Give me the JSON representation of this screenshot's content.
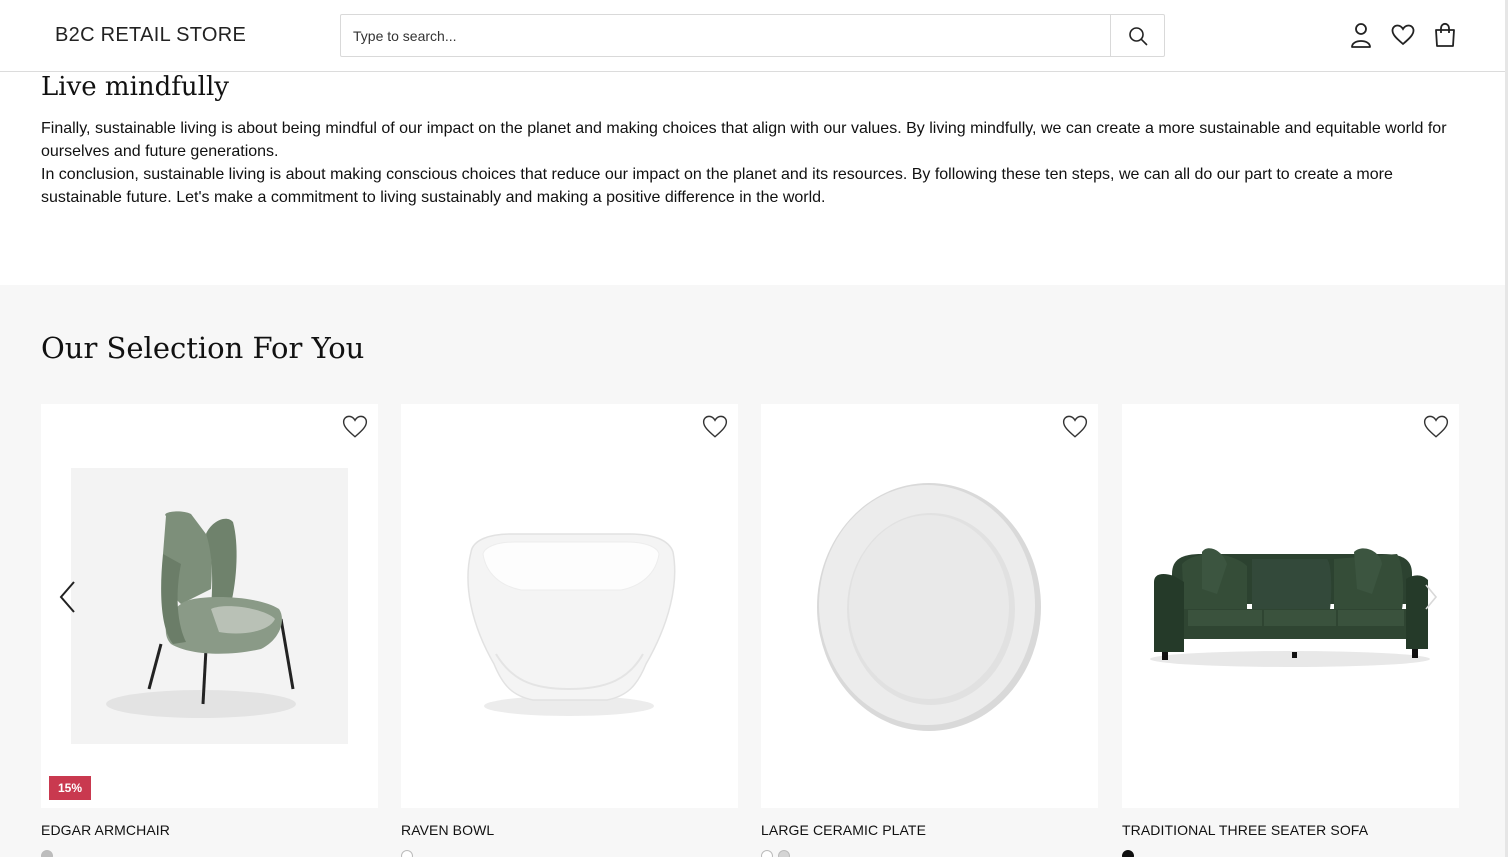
{
  "header": {
    "logo": "B2C RETAIL STORE",
    "search_placeholder": "Type to search...",
    "icons": [
      "search-icon",
      "user-icon",
      "heart-icon",
      "shopping-bag-icon"
    ]
  },
  "article": {
    "title": "Live mindfully",
    "paragraphs": [
      "Finally, sustainable living is about being mindful of our impact on the planet and making choices that align with our values. By living mindfully, we can create a more sustainable and equitable world for ourselves and future generations.",
      "In conclusion, sustainable living is about making conscious choices that reduce our impact on the planet and its resources. By following these ten steps, we can all do our part to create a more sustainable future. Let's make a commitment to living sustainably and making a positive difference in the world."
    ]
  },
  "selection": {
    "title": "Our Selection For You",
    "products": [
      {
        "name": "EDGAR ARMCHAIR",
        "badge": "15%",
        "image": "green-armchair",
        "swatches": [
          "#bdbdbd"
        ]
      },
      {
        "name": "RAVEN BOWL",
        "badge": "",
        "image": "white-bowl",
        "swatches": [
          "#ffffff"
        ]
      },
      {
        "name": "LARGE CERAMIC PLATE",
        "badge": "",
        "image": "ceramic-plate",
        "swatches": [
          "#ffffff",
          "#d4d4d4"
        ]
      },
      {
        "name": "TRADITIONAL THREE SEATER SOFA",
        "badge": "",
        "image": "green-sofa",
        "swatches": [
          "#111111"
        ]
      }
    ]
  },
  "colors": {
    "badge": "#c9394f",
    "section_bg": "#f7f7f7",
    "sofa": "#2f4532",
    "armchair": "#7d8f7a"
  }
}
